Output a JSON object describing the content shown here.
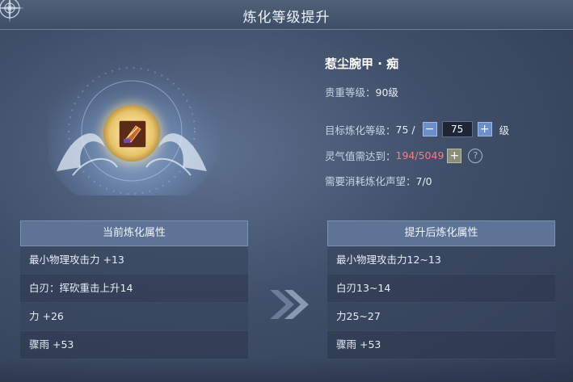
{
  "window": {
    "title": "炼化等级提升"
  },
  "item": {
    "name": "惹尘腕甲 · 痴",
    "rank_label": "贵重等级：",
    "rank_value": "90级"
  },
  "target_level": {
    "label": "目标炼化等级：",
    "current": "75 /",
    "minus": "−",
    "value": "75",
    "plus": "+",
    "unit": "级"
  },
  "aura": {
    "label": "灵气值需达到：",
    "value": "194/5049",
    "add": "+",
    "help": "?"
  },
  "prestige": {
    "label": "需要消耗炼化声望：",
    "value": "7/0"
  },
  "current_panel": {
    "header": "当前炼化属性",
    "props": [
      "最小物理攻击力 +13",
      "白刃：挥砍重击上升14",
      "力 +26",
      "骤雨 +53"
    ]
  },
  "upgraded_panel": {
    "header": "提升后炼化属性",
    "props": [
      "最小物理攻击力12~13",
      "白刃13~14",
      "力25~27",
      "骤雨 +53"
    ]
  },
  "colors": {
    "accent_red": "#ff7a7a",
    "button_blue": "#6d8fc8"
  },
  "icons": [
    "compass-ornament-icon",
    "wristguard-item-icon",
    "double-chevron-right-icon"
  ]
}
